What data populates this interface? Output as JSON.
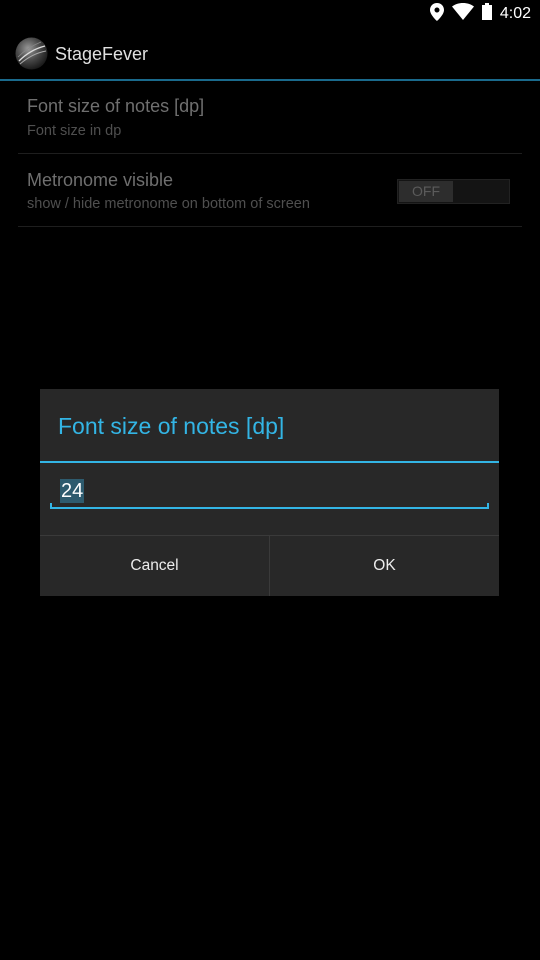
{
  "status_bar": {
    "time": "4:02",
    "icons": [
      "location-icon",
      "wifi-icon",
      "battery-icon"
    ]
  },
  "action_bar": {
    "app_icon": "stagefever-logo-icon",
    "title": "StageFever"
  },
  "preferences": [
    {
      "title": "Font size of notes [dp]",
      "summary": "Font size in dp"
    },
    {
      "title": "Metronome visible",
      "summary": "show / hide metronome on bottom of screen",
      "toggle_label": "OFF"
    }
  ],
  "dialog": {
    "title": "Font size of notes [dp]",
    "input_value": "24",
    "cancel_label": "Cancel",
    "ok_label": "OK"
  },
  "colors": {
    "accent": "#33b5e5",
    "background": "#000000",
    "dialog_background": "#282828"
  }
}
